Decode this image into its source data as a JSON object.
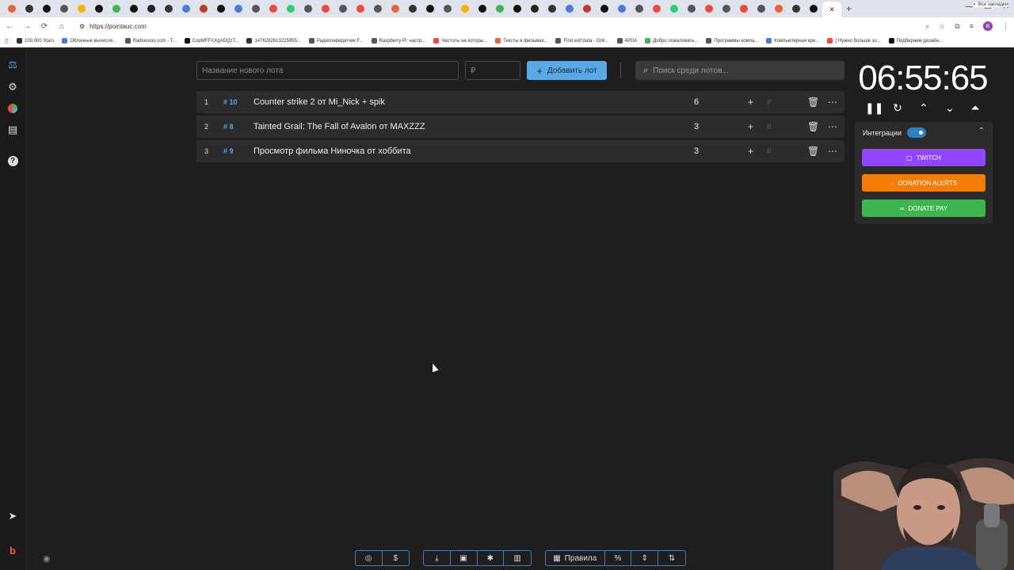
{
  "browser": {
    "url": "https://pointauc.com",
    "tab_count": 48,
    "bookmarks": [
      "100,000 Stars",
      "Облачные вычисле...",
      "Radiooooo.com - T...",
      "CopMFFXXgADQzT...",
      "1476282613225955...",
      "Радиопередатчик F...",
      "Raspberry Pi: настр...",
      "Частоты на которы...",
      "Тексты в фильмах...",
      "Find exif data - Onli...",
      "4PDA",
      "Добро пожаловать...",
      "Программы компа...",
      "Компьютерная кри...",
      "( Нужно больше зо...",
      "Подбираем дизайн..."
    ],
    "bookmarks_right": "Все закладки",
    "profile_initial": "B"
  },
  "form": {
    "name_placeholder": "Название нового лота",
    "amount_placeholder": "₽",
    "add_label": "Добавить лот",
    "search_placeholder": "Поиск среди лотов..."
  },
  "lots": [
    {
      "num": "1",
      "id": "# 10",
      "name": "Counter strike 2 от Mi_Nick + spik",
      "amount": "6"
    },
    {
      "num": "2",
      "id": "# 8",
      "name": "Tainted Grail: The Fall of Avalon от MAXZZZ",
      "amount": "3"
    },
    {
      "num": "3",
      "id": "# 9",
      "name": "Просмотр фильма Ниночка от хоббита",
      "amount": "3"
    }
  ],
  "timer": {
    "display": "06:55:65"
  },
  "integrations": {
    "label": "Интеграции",
    "enabled": true,
    "services": [
      {
        "label": "TWITCH",
        "color": "#9146ff"
      },
      {
        "label": "DONATION ALERTS",
        "color": "#f57d07"
      },
      {
        "label": "DONATE PAY",
        "color": "#3fb54d"
      }
    ]
  },
  "bottom": {
    "rules_label": "Правила"
  },
  "colors": {
    "accent": "#5aa9e6",
    "background": "#1e1e1e",
    "row": "#2c2c2c"
  }
}
